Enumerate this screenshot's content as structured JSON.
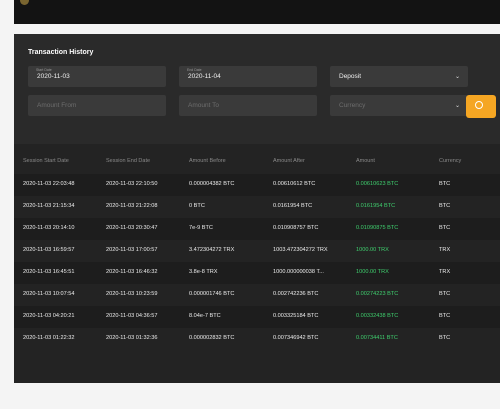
{
  "page": {
    "title": "Transaction History"
  },
  "filters": {
    "start_date": {
      "label": "Start Date",
      "value": "2020-11-03"
    },
    "end_date": {
      "label": "End Date",
      "value": "2020-11-04"
    },
    "type": {
      "value": "Deposit"
    },
    "amount_from": {
      "placeholder": "Amount From"
    },
    "amount_to": {
      "placeholder": "Amount To"
    },
    "currency": {
      "placeholder": "Currency"
    }
  },
  "table": {
    "headers": [
      "Session Start Date",
      "Session End Date",
      "Amount Before",
      "Amount After",
      "Amount",
      "Currency"
    ],
    "rows": [
      [
        "2020-11-03 22:03:48",
        "2020-11-03 22:10:50",
        "0.000004382 BTC",
        "0.00610612 BTC",
        "0.00610623 BTC",
        "BTC"
      ],
      [
        "2020-11-03 21:15:34",
        "2020-11-03 21:22:08",
        "0 BTC",
        "0.0161954 BTC",
        "0.0161954 BTC",
        "BTC"
      ],
      [
        "2020-11-03 20:14:10",
        "2020-11-03 20:30:47",
        "7e-9 BTC",
        "0.010908757 BTC",
        "0.01090875 BTC",
        "BTC"
      ],
      [
        "2020-11-03 16:59:57",
        "2020-11-03 17:00:57",
        "3.472304272 TRX",
        "1003.472304272 TRX",
        "1000.00 TRX",
        "TRX"
      ],
      [
        "2020-11-03 16:45:51",
        "2020-11-03 16:46:32",
        "3.8e-8 TRX",
        "1000.000000038 T...",
        "1000.00 TRX",
        "TRX"
      ],
      [
        "2020-11-03 10:07:54",
        "2020-11-03 10:23:59",
        "0.000001746 BTC",
        "0.002742236 BTC",
        "0.00274223 BTC",
        "BTC"
      ],
      [
        "2020-11-03 04:20:21",
        "2020-11-03 04:36:57",
        "8.04e-7 BTC",
        "0.003325184 BTC",
        "0.00332438 BTC",
        "BTC"
      ],
      [
        "2020-11-03 01:22:32",
        "2020-11-03 01:32:36",
        "0.000002832 BTC",
        "0.007346942 BTC",
        "0.00734411 BTC",
        "BTC"
      ]
    ]
  },
  "colors": {
    "accent": "#f5a623",
    "amount_positive": "#3fcf6e",
    "panel_bg": "#232323"
  },
  "icons": {
    "search_button": "search-icon",
    "dropdown": "chevron-down-icon"
  }
}
